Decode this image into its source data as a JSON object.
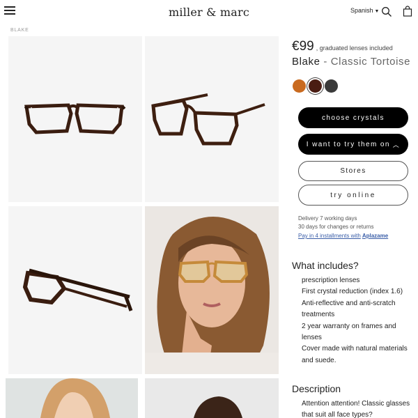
{
  "header": {
    "logo": "miller & marc",
    "language": "Spanish"
  },
  "breadcrumb": "BLAKE",
  "product": {
    "price": "€99",
    "price_note": ", graduated lenses included",
    "name": "Blake",
    "separator": "-",
    "variant": "Classic Tortoise",
    "swatches": [
      {
        "name": "amber",
        "color": "#c96a1f"
      },
      {
        "name": "tortoise",
        "color": "#4a1c12",
        "selected": true
      },
      {
        "name": "black",
        "color": "#3a3a3a"
      }
    ]
  },
  "buttons": {
    "choose_crystals": "choose crystals",
    "try_on": "I want to try them on",
    "stores": "Stores",
    "try_online": "try online"
  },
  "info": {
    "delivery": "Delivery 7 working days",
    "returns": "30 days for changes or returns",
    "installments": "Pay in 4 installments with",
    "installments_brand": "Aplazame"
  },
  "includes": {
    "title": "What includes?",
    "items": [
      "prescription lenses",
      "First crystal reduction (index 1.6)",
      "Anti-reflective and anti-scratch treatments",
      "2 year warranty on frames and lenses",
      "Cover made with natural materials and suede."
    ]
  },
  "description": {
    "title": "Description",
    "text": "Attention attention! Classic glasses that suit all face types?"
  },
  "icons": [
    "hamburger-icon",
    "caret-down-icon",
    "search-icon",
    "bag-icon",
    "chevron-up-icon"
  ]
}
